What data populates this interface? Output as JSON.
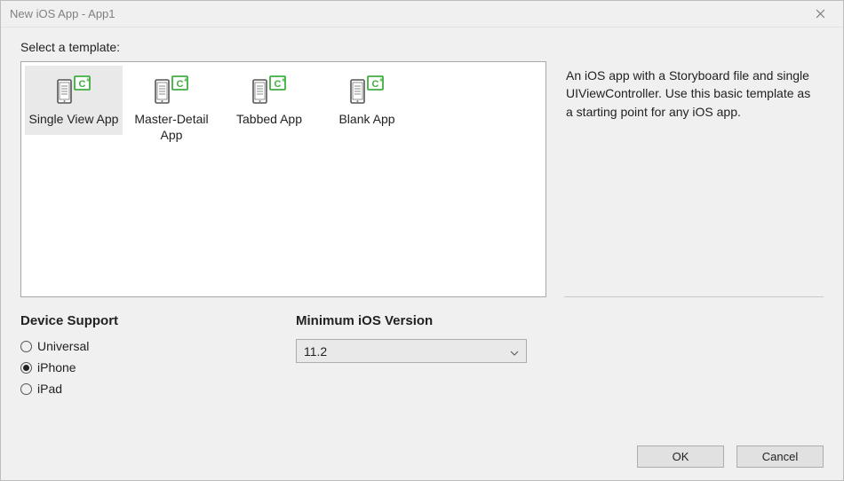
{
  "window": {
    "title": "New iOS App - App1"
  },
  "prompt": "Select a template:",
  "templates": [
    {
      "id": "single-view",
      "label": "Single View App",
      "selected": true
    },
    {
      "id": "master-detail",
      "label": "Master-Detail App",
      "selected": false
    },
    {
      "id": "tabbed",
      "label": "Tabbed App",
      "selected": false
    },
    {
      "id": "blank",
      "label": "Blank App",
      "selected": false
    }
  ],
  "description": "An iOS app with a Storyboard file and single UIViewController. Use this basic template as a starting point for any iOS app.",
  "device_support": {
    "heading": "Device Support",
    "options": [
      {
        "id": "universal",
        "label": "Universal",
        "checked": false
      },
      {
        "id": "iphone",
        "label": "iPhone",
        "checked": true
      },
      {
        "id": "ipad",
        "label": "iPad",
        "checked": false
      }
    ]
  },
  "min_ios": {
    "heading": "Minimum iOS Version",
    "selected": "11.2"
  },
  "buttons": {
    "ok": "OK",
    "cancel": "Cancel"
  }
}
